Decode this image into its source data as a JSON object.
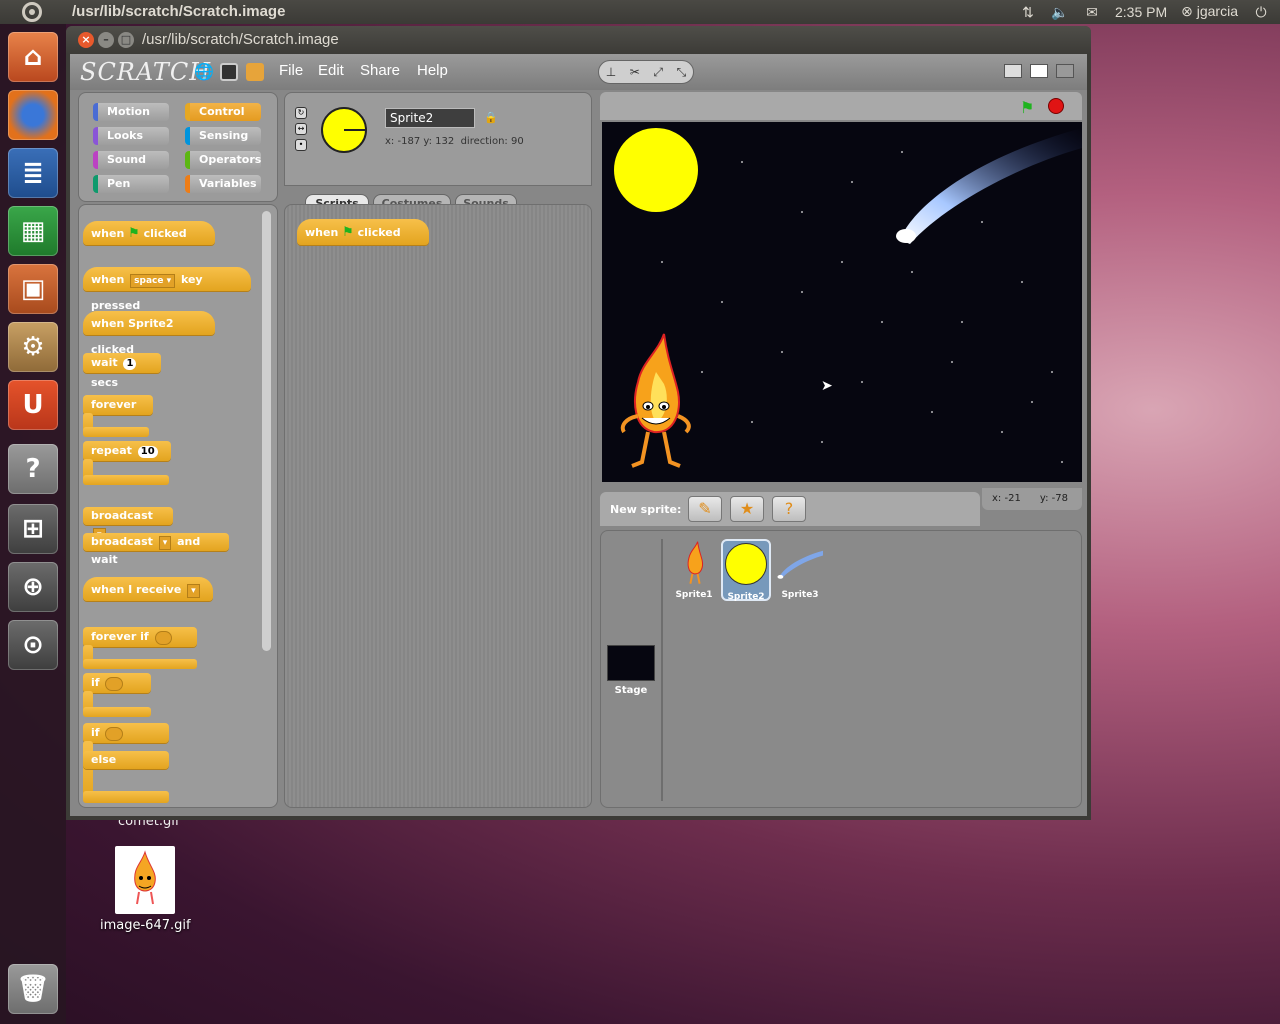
{
  "top_panel": {
    "title": "/usr/lib/scratch/Scratch.image",
    "time": "2:35 PM",
    "user": "jgarcia",
    "icons": [
      "network-icon",
      "volume-icon",
      "mail-icon",
      "user-icon"
    ]
  },
  "launcher": {
    "items": [
      "home-folder",
      "firefox",
      "writer",
      "calc",
      "impress",
      "ubuntu-software-center",
      "ubuntu-one",
      "help",
      "workspace-switcher",
      "zoom-in",
      "zoom-out"
    ],
    "trash": "trash"
  },
  "desktop": {
    "comet_label": "comet.gif",
    "image_label": "image-647.gif"
  },
  "window": {
    "title": "/usr/lib/scratch/Scratch.image"
  },
  "scratch": {
    "logo": "SCRATCH",
    "menus": [
      "File",
      "Edit",
      "Share",
      "Help"
    ],
    "categories": [
      {
        "label": "Motion",
        "color": "#4a6cd4"
      },
      {
        "label": "Control",
        "color": "#e6a822"
      },
      {
        "label": "Looks",
        "color": "#8a55d7"
      },
      {
        "label": "Sensing",
        "color": "#0094dd"
      },
      {
        "label": "Sound",
        "color": "#bb42c3"
      },
      {
        "label": "Operators",
        "color": "#5cb712"
      },
      {
        "label": "Pen",
        "color": "#0e9a6c"
      },
      {
        "label": "Variables",
        "color": "#ee7d16"
      }
    ],
    "selected_category": "Control",
    "blocks": {
      "when_flag": {
        "pre": "when",
        "post": "clicked"
      },
      "when_key": {
        "pre": "when",
        "key": "space",
        "post": "key pressed"
      },
      "when_sprite_clicked": "when Sprite2 clicked",
      "wait": {
        "pre": "wait",
        "value": "1",
        "post": "secs"
      },
      "forever": "forever",
      "repeat": {
        "pre": "repeat",
        "value": "10"
      },
      "broadcast": "broadcast",
      "broadcast_wait": {
        "pre": "broadcast",
        "post": "and wait"
      },
      "when_receive": "when I receive",
      "forever_if": "forever if",
      "if": "if",
      "if_else_if": "if",
      "else": "else"
    },
    "sprite_info": {
      "name": "Sprite2",
      "x_label": "x:",
      "x": "-187",
      "y_label": "y:",
      "y": "132",
      "direction_label": "direction:",
      "direction": "90"
    },
    "tabs": [
      "Scripts",
      "Costumes",
      "Sounds"
    ],
    "active_tab": "Scripts",
    "script_block": {
      "pre": "when",
      "post": "clicked"
    },
    "mouse": {
      "x_label": "x:",
      "x": "-21",
      "y_label": "y:",
      "y": "-78"
    },
    "new_sprite_label": "New sprite:",
    "sprites": [
      {
        "name": "Sprite1",
        "selected": false
      },
      {
        "name": "Sprite2",
        "selected": true
      },
      {
        "name": "Sprite3",
        "selected": false
      }
    ],
    "stage_label": "Stage"
  }
}
